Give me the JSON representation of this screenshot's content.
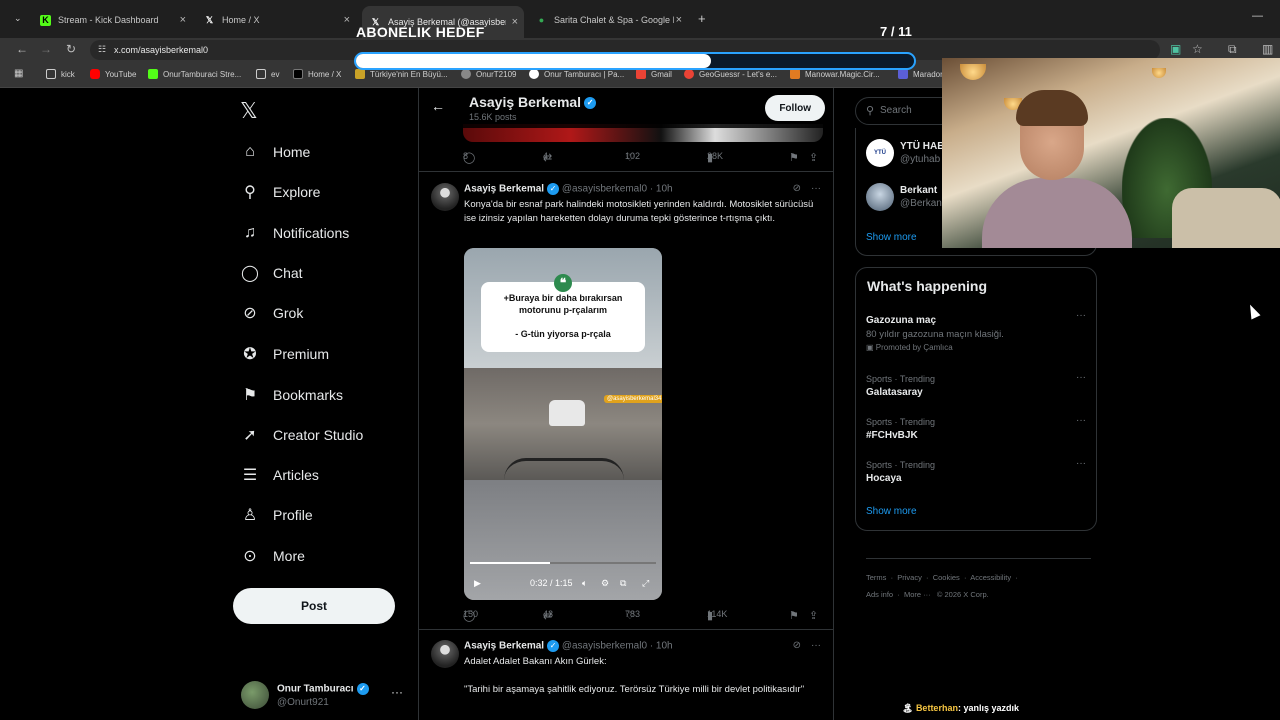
{
  "browser": {
    "tabs": [
      {
        "title": "Stream - Kick Dashboard",
        "icon": "kick-icon"
      },
      {
        "title": "Home / X",
        "icon": "x-icon"
      },
      {
        "title": "Asayiş Berkemal (@asayisberk...",
        "icon": "x-icon"
      },
      {
        "title": "Sarita Chalet & Spa - Google H...",
        "icon": "maps-pin-icon"
      }
    ],
    "url": "x.com/asayisberkemal0",
    "bookmarks": [
      "kick",
      "YouTube",
      "OnurTamburaci Stre...",
      "ev",
      "Home / X",
      "Türkiye'nin En Büyü...",
      "OnurT2109",
      "Onur Tamburacı | Pa...",
      "Gmail",
      "GeoGuessr - Let's e...",
      "Manowar.Magic.Cir...",
      "Maradon"
    ]
  },
  "overlay": {
    "title": "ABONELIK HEDEF",
    "count": "7 / 11",
    "progress": 0.636
  },
  "sidebar": {
    "items": [
      {
        "label": "Home",
        "icon": "home-icon",
        "glyph": "⌂"
      },
      {
        "label": "Explore",
        "icon": "search-icon",
        "glyph": "⚲"
      },
      {
        "label": "Notifications",
        "icon": "bell-icon",
        "glyph": "♫"
      },
      {
        "label": "Chat",
        "icon": "chat-bubble-icon",
        "glyph": "◯"
      },
      {
        "label": "Grok",
        "icon": "grok-icon",
        "glyph": "⊘"
      },
      {
        "label": "Premium",
        "icon": "premium-badge-icon",
        "glyph": "✪"
      },
      {
        "label": "Bookmarks",
        "icon": "bookmark-icon",
        "glyph": "⚑"
      },
      {
        "label": "Creator Studio",
        "icon": "rocket-icon",
        "glyph": "➚"
      },
      {
        "label": "Articles",
        "icon": "articles-icon",
        "glyph": "☰"
      },
      {
        "label": "Profile",
        "icon": "person-icon",
        "glyph": "♙"
      },
      {
        "label": "More",
        "icon": "more-circle-icon",
        "glyph": "⊙"
      }
    ],
    "post_label": "Post",
    "account": {
      "name": "Onur Tamburacı",
      "handle": "@Onurt921"
    }
  },
  "profile_header": {
    "name": "Asayiş Berkemal",
    "posts": "15.6K posts",
    "follow_label": "Follow"
  },
  "prev_tweet_actions": {
    "replies": "8",
    "reposts": "4",
    "likes": "102",
    "views": "28K"
  },
  "tweet1": {
    "name": "Asayiş Berkemal",
    "handle": "@asayisberkemal0",
    "time": "10h",
    "text": "Konya'da bir esnaf park halindeki motosikleti yerinden kaldırdı. Motosiklet sürücüsü ise izinsiz yapılan hareketten dolayı duruma tepki gösterince t-rtışma çıktı.",
    "video_caption_1": "+Buraya bir daha bırakırsan motorunu p-rçalarım",
    "video_caption_2": "- G-tün yiyorsa p-rçala",
    "video_tag": "@asayisberkemal34",
    "video_time": "0:32 / 1:15",
    "video_progress": 0.43,
    "actions": {
      "replies": "150",
      "reposts": "43",
      "likes": "783",
      "views": "114K"
    }
  },
  "tweet2": {
    "name": "Asayiş Berkemal",
    "handle": "@asayisberkemal0",
    "time": "10h",
    "text1": "Adalet Adalet Bakanı Akın Gürlek:",
    "text2": "\"Tarihi bir aşamaya şahitlik ediyoruz. Terörsüz Türkiye milli bir devlet politikasıdır\""
  },
  "right": {
    "search_placeholder": "Search",
    "who_to_follow": [
      {
        "name": "YTÜ HAB",
        "handle": "@ytuhab"
      },
      {
        "name": "Berkant",
        "handle": "@Berkan"
      }
    ],
    "show_more": "Show more",
    "happening_title": "What's happening",
    "trends": [
      {
        "context": "",
        "title": "Gazozuna maç",
        "desc": "80 yıldır gazozuna maçın klasiği.",
        "promoted": "Promoted by Çamlıca"
      },
      {
        "context": "Sports · Trending",
        "title": "Galatasaray"
      },
      {
        "context": "Sports · Trending",
        "title": "#FCHvBJK"
      },
      {
        "context": "Sports · Trending",
        "title": "Hocaya"
      }
    ],
    "footer": [
      "Terms",
      "Privacy",
      "Cookies",
      "Accessibility",
      "Ads info",
      "More ···",
      "© 2026 X Corp."
    ]
  },
  "chat": {
    "user": "Betterhan",
    "message": ": yanlış yazdık"
  }
}
